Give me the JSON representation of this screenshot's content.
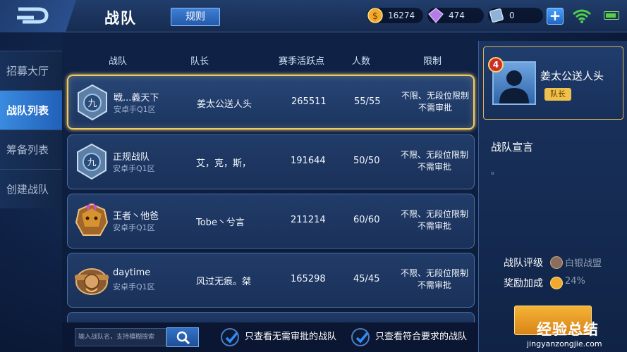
{
  "header": {
    "title": "战队",
    "rules_label": "规则",
    "gold": "16274",
    "diamond": "474",
    "coupon": "0"
  },
  "nav": {
    "items": [
      {
        "label": "招募大厅"
      },
      {
        "label": "战队列表"
      },
      {
        "label": "筹备列表"
      },
      {
        "label": "创建战队"
      }
    ]
  },
  "list": {
    "columns": [
      "战队",
      "队长",
      "赛季活跃点",
      "人数",
      "限制"
    ],
    "rows": [
      {
        "name": "戦...義天下",
        "server": "安卓手Q1区",
        "captain": "姜太公送人头",
        "activity": "265511",
        "members": "55/55",
        "limit1": "不限、无段位限制",
        "limit2": "不需审批"
      },
      {
        "name": "正规战队",
        "server": "安卓手Q1区",
        "captain": "艾，克，斯，",
        "activity": "191644",
        "members": "50/50",
        "limit1": "不限、无段位限制",
        "limit2": "不需审批"
      },
      {
        "name": "王者丶他爸",
        "server": "安卓手Q1区",
        "captain": "Tobe丶兮言",
        "activity": "211214",
        "members": "60/60",
        "limit1": "不限、无段位限制",
        "limit2": "不需审批"
      },
      {
        "name": "daytime",
        "server": "安卓手Q1区",
        "captain": "风过无痕。桀",
        "activity": "165298",
        "members": "45/45",
        "limit1": "不限、无段位限制",
        "limit2": "不需审批"
      }
    ]
  },
  "bottom": {
    "search_placeholder": "输入战队名，支持模糊搜索",
    "filter1": "只查看无需审批的战队",
    "filter2": "只查看符合要求的战队"
  },
  "panel": {
    "level": "4",
    "captain_name": "姜太公送人头",
    "role": "队长",
    "declaration_title": "战队宣言",
    "declaration_text": "。",
    "rating_label": "战队评级",
    "rating_value": "白银战盟",
    "bonus_label": "奖励加成",
    "bonus_value": "24%"
  },
  "watermark": {
    "main": "经验总结",
    "sub": "jingyanzongjie.com"
  }
}
